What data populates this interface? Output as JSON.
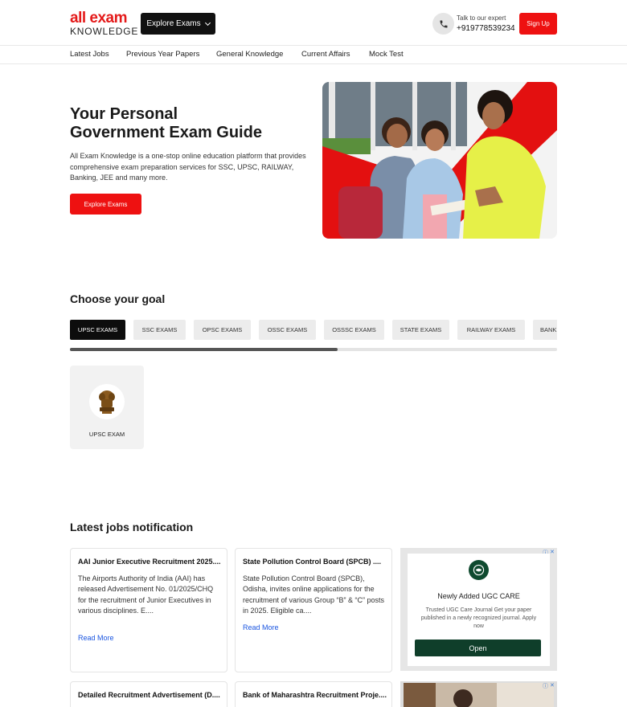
{
  "header": {
    "logo_top": "all exam",
    "logo_bottom": "KNOWLEDGE",
    "explore_label": "Explore Exams",
    "expert_label": "Talk to our expert",
    "expert_phone": "+919778539234",
    "signup_label": "Sign Up"
  },
  "nav": {
    "items": [
      "Latest Jobs",
      "Previous Year Papers",
      "General Knowledge",
      "Current Affairs",
      "Mock Test"
    ]
  },
  "hero": {
    "title_line1": "Your Personal",
    "title_line2": "Government Exam Guide",
    "description": "All Exam Knowledge is a one-stop online education platform that provides comprehensive exam preparation services for SSC, UPSC, RAILWAY, Banking, JEE and many more.",
    "cta_label": "Explore Exams"
  },
  "goal": {
    "title": "Choose your goal",
    "tabs": [
      "UPSC EXAMS",
      "SSC EXAMS",
      "OPSC EXAMS",
      "OSSC EXAMS",
      "OSSSC EXAMS",
      "STATE EXAMS",
      "RAILWAY EXAMS",
      "BANKING EXAMS"
    ],
    "active_tab": "UPSC EXAMS",
    "scroll_fraction": 0.55,
    "card_label": "UPSC EXAM"
  },
  "jobs": {
    "title": "Latest jobs notification",
    "cards": [
      {
        "title": "AAI Junior Executive Recruitment 2025....",
        "description": "The Airports Authority of India (AAI) has released Advertisement No. 01/2025/CHQ for the recruitment of Junior Executives in various disciplines. E....",
        "read_more": "Read More"
      },
      {
        "title": "State Pollution Control Board (SPCB) ....",
        "description": "State Pollution Control Board (SPCB), Odisha, invites online applications for the recruitment of various Group “B” & “C” posts in 2025. Eligible ca....",
        "read_more": "Read More"
      },
      {
        "title": "Detailed Recruitment Advertisement (D....",
        "description": "",
        "read_more": ""
      },
      {
        "title": "Bank of Maharashtra Recruitment Proje....",
        "description": "",
        "read_more": ""
      }
    ]
  },
  "ad": {
    "title": "Newly Added UGC CARE",
    "description": "Trusted UGC Care Journal Get your paper published in a newly recognized journal. Apply now",
    "button_label": "Open"
  },
  "colors": {
    "brand_red": "#ee1111",
    "dark": "#111111",
    "link_blue": "#1a55e0",
    "ad_green": "#0f3e2a"
  },
  "icons": [
    "phone-icon",
    "chevron-down-icon",
    "national-emblem-icon",
    "ad-info-icon",
    "ad-close-icon"
  ]
}
